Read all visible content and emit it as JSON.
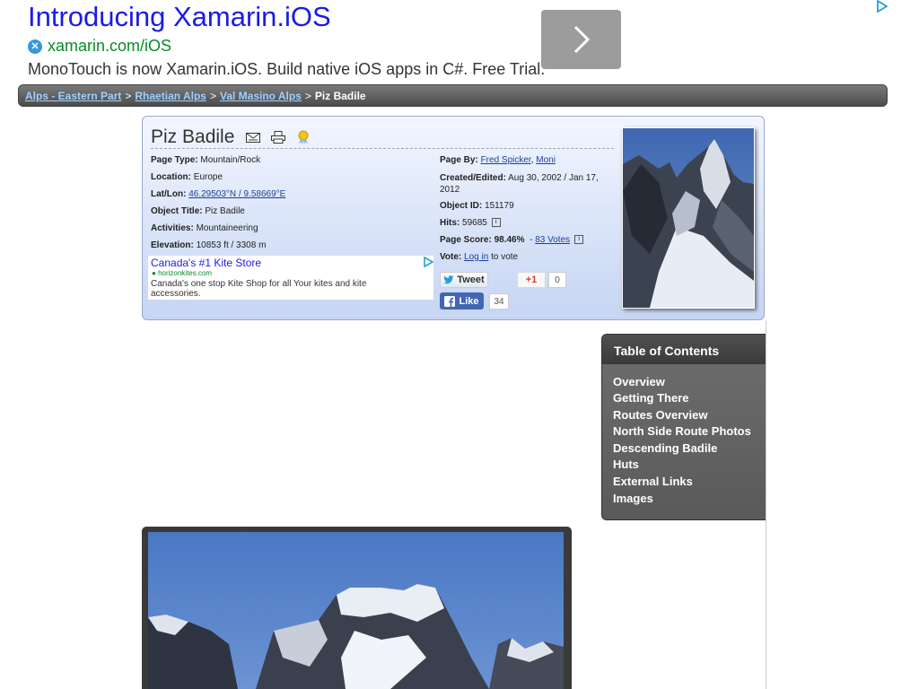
{
  "top_ad": {
    "title": "Introducing Xamarin.iOS",
    "url": "xamarin.com/iOS",
    "description": "MonoTouch is now Xamarin.iOS. Build native iOS apps in C#. Free Trial."
  },
  "breadcrumb": {
    "items": [
      "Alps - Eastern Part",
      "Rhaetian Alps",
      "Val Masino Alps"
    ],
    "separator": ">",
    "current": "Piz Badile"
  },
  "summary": {
    "title": "Piz Badile",
    "left_fields": [
      {
        "label": "Page Type:",
        "value": "Mountain/Rock"
      },
      {
        "label": "Location:",
        "value": "Europe"
      },
      {
        "label": "Lat/Lon:",
        "value": "46.29503°N / 9.58669°E"
      },
      {
        "label": "Object Title:",
        "value": "Piz Badile"
      },
      {
        "label": "Activities:",
        "value": "Mountaineering"
      },
      {
        "label": "Elevation:",
        "value": "10853 ft / 3308 m"
      }
    ],
    "page_by_label": "Page By:",
    "authors": [
      "Fred Spicker",
      "Moni"
    ],
    "author_separator": ",",
    "created_label": "Created/Edited:",
    "created_value": "Aug 30, 2002 / Jan 17, 2012",
    "object_id_label": "Object ID:",
    "object_id": "151179",
    "hits_label": "Hits:",
    "hits": "59685",
    "score_label": "Page Score:",
    "score": "98.46%",
    "score_dash": "-",
    "votes_link": "83 Votes",
    "vote_label": "Vote:",
    "login_link": "Log in",
    "vote_suffix": "to vote",
    "info_glyph": "i"
  },
  "inner_ad": {
    "title": "Canada's #1 Kite Store",
    "url": "horizonkites.com",
    "description": "Canada's one stop Kite Shop for all Your kites and kite accessories."
  },
  "social": {
    "tweet_label": "Tweet",
    "gplus_label": "+1",
    "gplus_count": "0",
    "like_label": "Like",
    "like_count": "34"
  },
  "toc": {
    "title": "Table of Contents",
    "items": [
      "Overview",
      "Getting There",
      "Routes Overview",
      "North Side Route Photos",
      "Descending Badile",
      "Huts",
      "External Links",
      "Images"
    ]
  },
  "colors": {
    "breadcrumb_link": "#9fd0ff",
    "card_top": "#f2f6ff",
    "card_bottom": "#c6d5f3",
    "toc_bg": "#5a5a5a",
    "ad_title": "#1a1aea",
    "ad_url": "#0a8a2a",
    "facebook": "#4267b2"
  },
  "icons": [
    "x-logo-icon",
    "chevron-right-icon",
    "adchoices-icon",
    "email-icon",
    "print-icon",
    "award-icon",
    "twitter-icon",
    "facebook-icon",
    "info-icon"
  ]
}
